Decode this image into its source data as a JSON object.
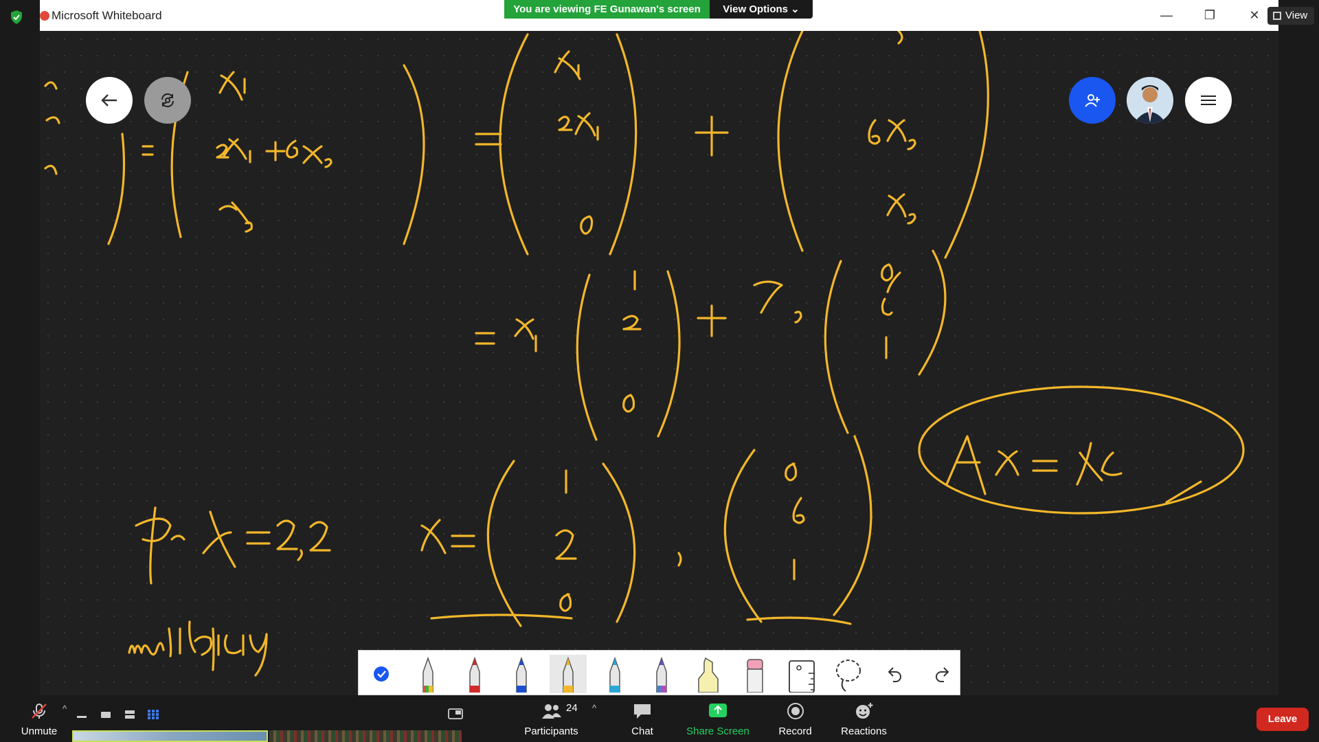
{
  "window": {
    "title": "Microsoft Whiteboard"
  },
  "share_banner": {
    "viewing_text": "You are viewing FE Gunawan's screen",
    "view_options_label": "View Options"
  },
  "view_chip": {
    "label": "View"
  },
  "whiteboard": {
    "ink_color": "#F2B72A",
    "handwritten_text": [
      "x1, x2, x3 = (x1, 2x1 + 6x3, x3) = (x1, 2x1, 0) + (0, 6x3, x3)",
      "= x1 (1, 2, 0) + x3 (0, 6, 1)",
      "Ax = λx",
      "for λ = 2, 2    x = (1, 2, 0), (0, 6, 1)",
      "multiplicity"
    ],
    "floating_buttons": [
      "back-arrow-icon",
      "sync-icon",
      "invite-user-icon",
      "avatar",
      "menu-icon"
    ]
  },
  "pen_toolbar": {
    "tools": [
      "select",
      "pen-rainbow",
      "pen-red",
      "pen-blue",
      "pen-yellow",
      "pen-cyan",
      "pen-galaxy",
      "highlighter",
      "eraser",
      "ruler",
      "lasso",
      "undo",
      "redo"
    ],
    "active_tool": "pen-yellow"
  },
  "meeting_controls": {
    "unmute_label": "Unmute",
    "participants_label": "Participants",
    "participant_count": "24",
    "chat_label": "Chat",
    "share_screen_label": "Share Screen",
    "record_label": "Record",
    "reactions_label": "Reactions",
    "leave_label": "Leave",
    "colors": {
      "share_screen": "#23D160",
      "leave": "#D1291F",
      "invite": "#1A57F0",
      "banner": "#23A33A"
    }
  }
}
